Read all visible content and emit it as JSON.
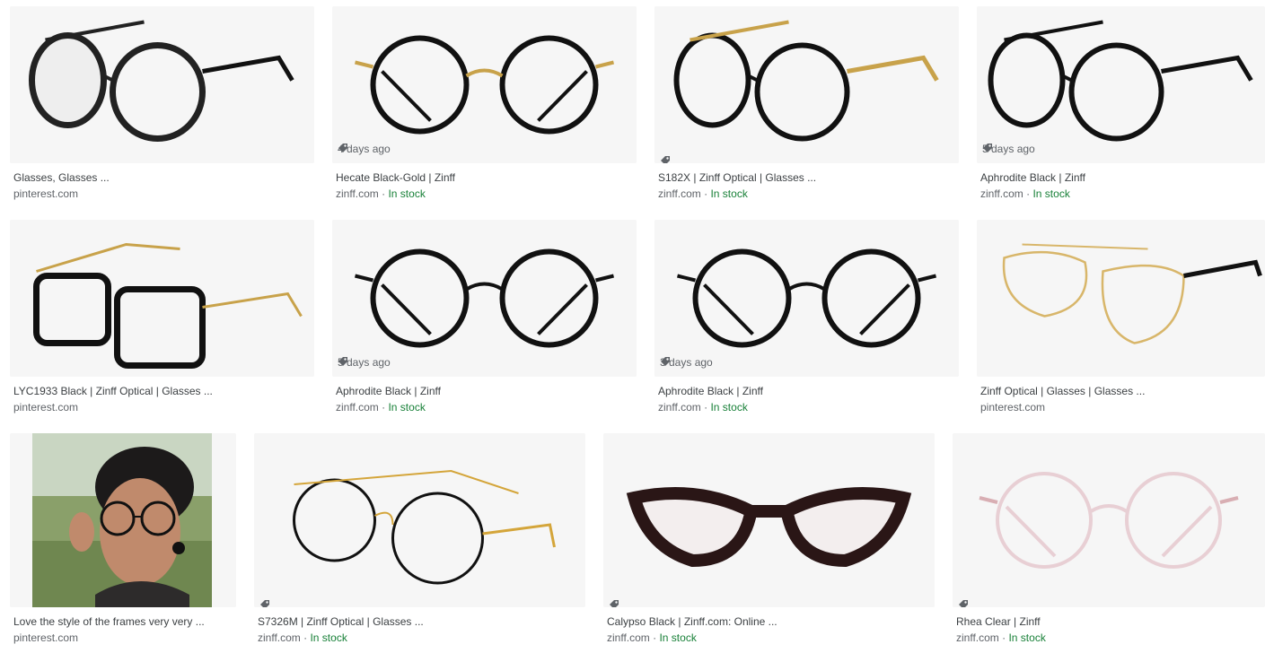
{
  "results": [
    {
      "title": "Glasses, Glasses ...",
      "source": "pinterest.com",
      "stock": "",
      "badge": "",
      "tag": false,
      "style": "black-fade"
    },
    {
      "title": "Hecate Black-Gold | Zinff",
      "source": "zinff.com",
      "stock": "In stock",
      "badge": "4 days ago",
      "tag": true,
      "style": "round-black-gold"
    },
    {
      "title": "S182X | Zinff Optical | Glasses ...",
      "source": "zinff.com",
      "stock": "In stock",
      "badge": "",
      "tag": true,
      "style": "cateye-gold-side"
    },
    {
      "title": "Aphrodite Black | Zinff",
      "source": "zinff.com",
      "stock": "In stock",
      "badge": "5 days ago",
      "tag": true,
      "style": "round-black-side"
    },
    {
      "title": "LYC1933 Black | Zinff Optical | Glasses ...",
      "source": "pinterest.com",
      "stock": "",
      "badge": "",
      "tag": false,
      "style": "square-gold-side"
    },
    {
      "title": "Aphrodite Black | Zinff",
      "source": "zinff.com",
      "stock": "In stock",
      "badge": "5 days ago",
      "tag": true,
      "style": "round-black-front"
    },
    {
      "title": "Aphrodite Black | Zinff",
      "source": "zinff.com",
      "stock": "In stock",
      "badge": "3 days ago",
      "tag": true,
      "style": "round-black-front2"
    },
    {
      "title": "Zinff Optical | Glasses | Glasses ...",
      "source": "pinterest.com",
      "stock": "",
      "badge": "",
      "tag": false,
      "style": "aviator-gold"
    },
    {
      "title": "Love the style of the frames very very ...",
      "source": "pinterest.com",
      "stock": "",
      "badge": "",
      "tag": false,
      "style": "photo"
    },
    {
      "title": "S7326M | Zinff Optical | Glasses ...",
      "source": "zinff.com",
      "stock": "In stock",
      "badge": "",
      "tag": true,
      "style": "round-gold-wire"
    },
    {
      "title": "Calypso Black | Zinff.com: Online ...",
      "source": "zinff.com",
      "stock": "In stock",
      "badge": "",
      "tag": true,
      "style": "cateye-black"
    },
    {
      "title": "Rhea Clear | Zinff",
      "source": "zinff.com",
      "stock": "In stock",
      "badge": "",
      "tag": true,
      "style": "clear-pink"
    }
  ],
  "separator": " · ",
  "colors": {
    "tile": "#f6f6f6",
    "title": "#3c4043",
    "source": "#5f6368",
    "in_stock": "#188038"
  }
}
